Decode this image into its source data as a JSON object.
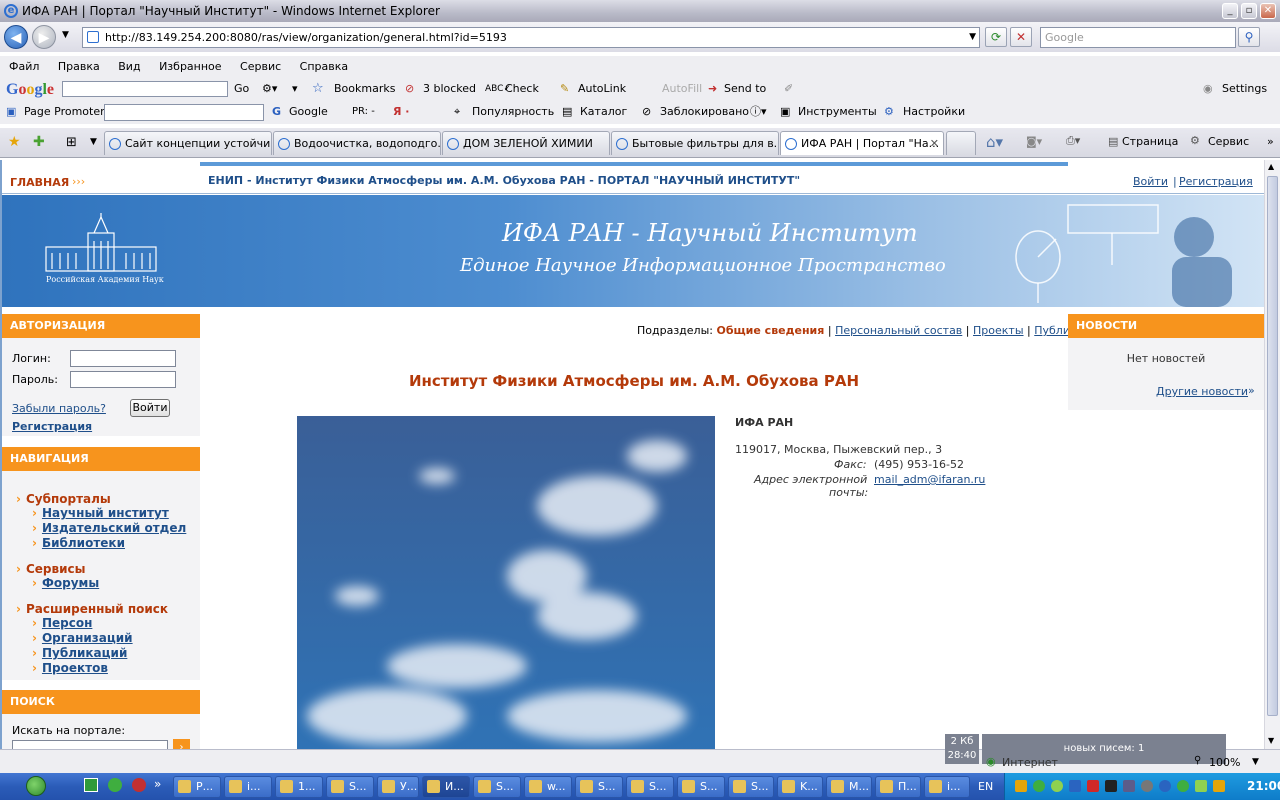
{
  "window": {
    "title": "ИФА РАН | Портал \"Научный Институт\" - Windows Internet Explorer"
  },
  "address": {
    "url": "http://83.149.254.200:8080/ras/view/organization/general.html?id=5193",
    "search_placeholder": "Google"
  },
  "menu": [
    "Файл",
    "Правка",
    "Вид",
    "Избранное",
    "Сервис",
    "Справка"
  ],
  "google_toolbar": {
    "logo": "Google",
    "go": "Go",
    "bookmarks": "Bookmarks",
    "blocked": "3 blocked",
    "check": "Check",
    "autolink": "AutoLink",
    "autofill": "AutoFill",
    "send_to": "Send to",
    "settings": "Settings"
  },
  "promoter_toolbar": {
    "label": "Page Promoter",
    "google": "Google",
    "pr": "PR: -",
    "ya": "Я ·",
    "popularity": "Популярность",
    "catalog": "Каталог",
    "blocked": "Заблокировано",
    "tools": "Инструменты",
    "settings": "Настройки"
  },
  "tabs": [
    "Сайт концепции устойчи...",
    "Водоочистка, водоподго...",
    "ДОМ ЗЕЛЕНОЙ ХИМИИ",
    "Бытовые фильтры для в...",
    "ИФА РАН | Портал \"На..."
  ],
  "cmdbar": {
    "page": "Страница",
    "service": "Сервис"
  },
  "site": {
    "home": "ГЛАВНАЯ",
    "arrows": "›››",
    "header_title": "ЕНИП - Институт Физики Атмосферы им. А.М. Обухова РАН - ПОРТАЛ \"НАУЧНЫЙ ИНСТИТУТ\"",
    "login_link": "Войти",
    "register_link": " Регистрация",
    "banner_title": "ИФА РАН - Научный Институт",
    "banner_subtitle": "Единое Научное Информационное Пространство",
    "banner_caption": "Российская Академия Наук"
  },
  "auth": {
    "heading": "АВТОРИЗАЦИЯ",
    "login_label": "Логин:",
    "password_label": "Пароль:",
    "forgot": "Забыли пароль?",
    "submit": "Войти",
    "register": "Регистрация"
  },
  "nav": {
    "heading": "НАВИГАЦИЯ",
    "groups": [
      {
        "label": "Субпорталы",
        "items": [
          "Научный институт",
          "Издательский отдел",
          "Библиотеки"
        ]
      },
      {
        "label": "Сервисы",
        "items": [
          "Форумы"
        ]
      },
      {
        "label": "Расширенный поиск",
        "items": [
          "Персон",
          "Организаций",
          "Публикаций",
          "Проектов"
        ]
      }
    ]
  },
  "search": {
    "heading": "ПОИСК",
    "label": "Искать на портале:"
  },
  "subsections": {
    "label": "Подразделы:",
    "current": "Общие сведения",
    "links": [
      "Персональный состав",
      "Проекты",
      "Публикации"
    ]
  },
  "org": {
    "title": "Институт Физики Атмосферы им. А.М. Обухова РАН",
    "short": "ИФА РАН",
    "address": "119017, Москва, Пыжевский пер., 3",
    "fax_label": "Факс:",
    "fax": "(495) 953-16-52",
    "email_label_1": "Адрес электронной",
    "email_label_2": "почты:",
    "email": "mail_adm@ifaran.ru"
  },
  "news": {
    "heading": "НОВОСТИ",
    "empty": "Нет новостей",
    "other": "Другие новости",
    "other_arrow": "»"
  },
  "statusbar": {
    "size": "2 Кб",
    "time": "28:40",
    "mail": "новых писем: 1",
    "zone": "Интернет",
    "zoom": "100%"
  },
  "taskbar": {
    "items": [
      "Р...",
      "i...",
      "1...",
      "S...",
      "У...",
      "И...",
      "S...",
      "w...",
      "S...",
      "S...",
      "S...",
      "S...",
      "K...",
      "M...",
      "П...",
      "i..."
    ],
    "lang": "EN",
    "clock": "21:00"
  },
  "colors": {
    "orange": "#f7941d",
    "link": "#1f4f8a",
    "title_red": "#b43a0a",
    "banner_blue": "#2f73bd"
  }
}
